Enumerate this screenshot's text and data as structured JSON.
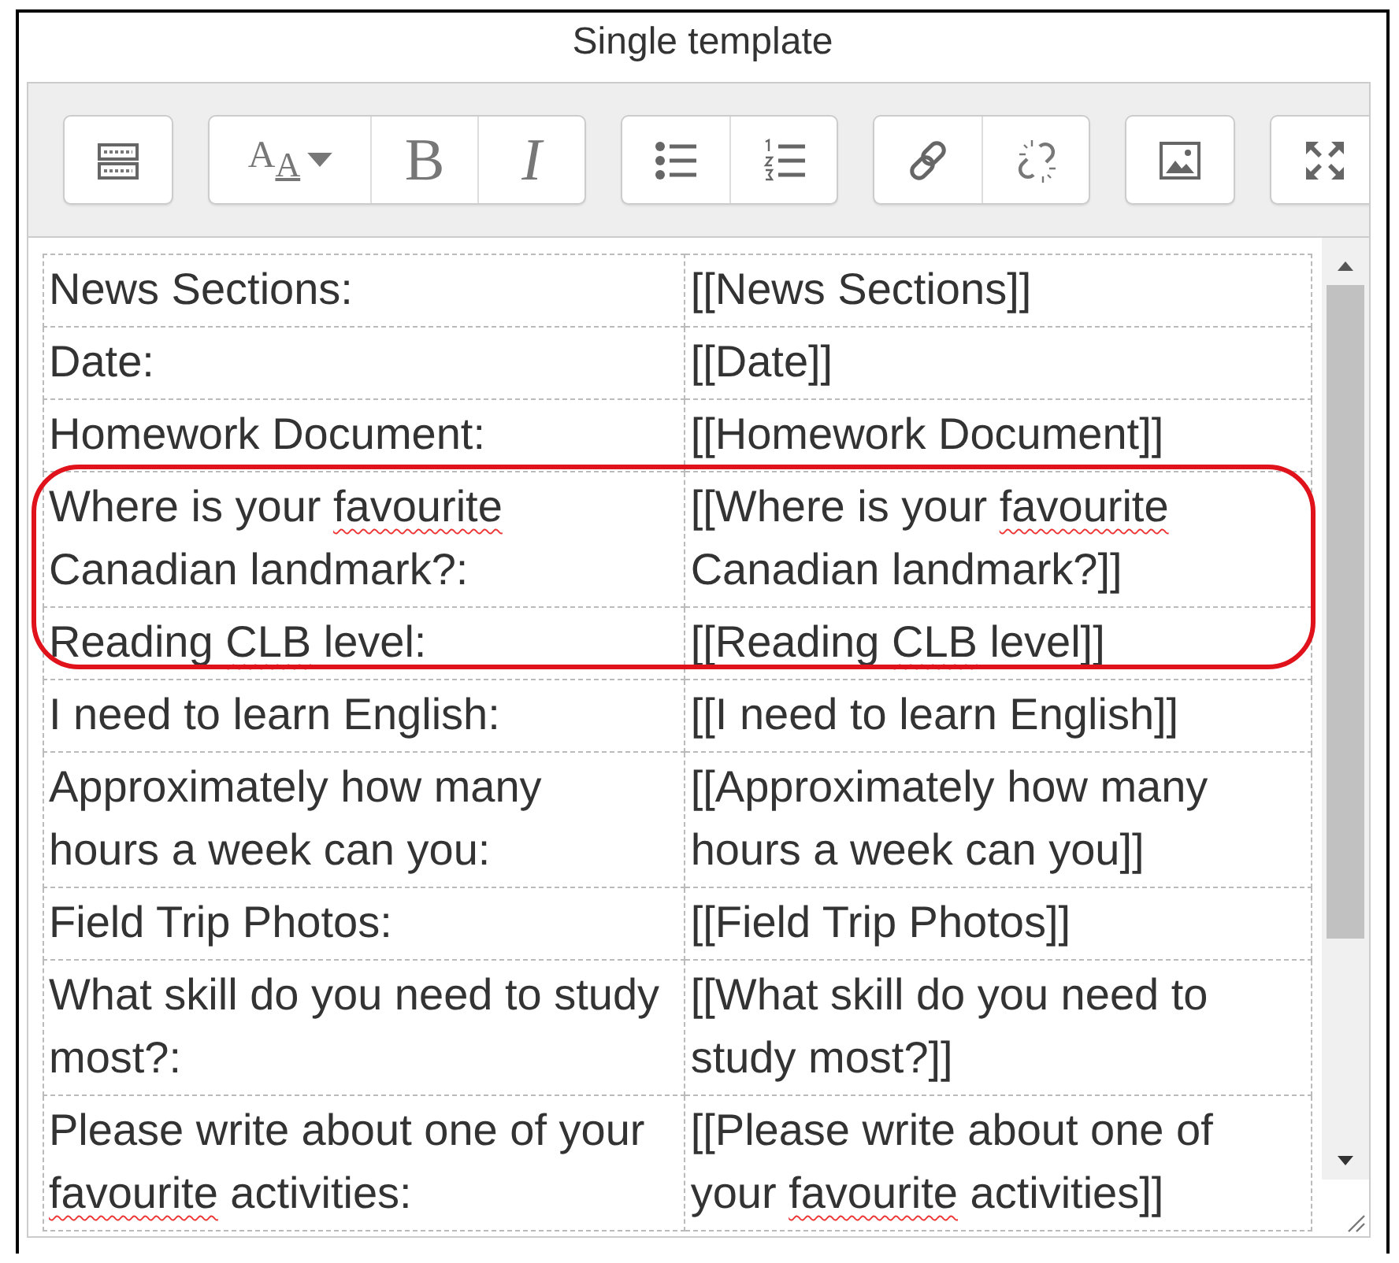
{
  "title": "Single template",
  "toolbar": [
    [
      {
        "kind": "toolbar-toggle"
      }
    ],
    [
      {
        "kind": "styles",
        "label": "A$_{A}$"
      },
      {
        "kind": "bold",
        "label": "B"
      },
      {
        "kind": "italic",
        "label": "I"
      }
    ],
    [
      {
        "kind": "bullets"
      },
      {
        "kind": "numbered"
      }
    ],
    [
      {
        "kind": "link"
      },
      {
        "kind": "unlink"
      }
    ],
    [
      {
        "kind": "image"
      }
    ],
    [
      {
        "kind": "fullscreen"
      }
    ]
  ],
  "rows": [
    {
      "highlighted": false,
      "cells": [
        [
          {
            "text": "News Sections:",
            "misspelled": false
          }
        ],
        [
          {
            "text": "[[News Sections]]",
            "misspelled": false
          }
        ]
      ]
    },
    {
      "highlighted": false,
      "cells": [
        [
          {
            "text": "Date:",
            "misspelled": false
          }
        ],
        [
          {
            "text": "[[Date]]",
            "misspelled": false
          }
        ]
      ]
    },
    {
      "highlighted": false,
      "cells": [
        [
          {
            "text": "Homework Document:",
            "misspelled": false
          }
        ],
        [
          {
            "text": "[[Homework Document]]",
            "misspelled": false
          }
        ]
      ]
    },
    {
      "highlighted": true,
      "cells": [
        [
          {
            "text": "Where is your ",
            "misspelled": false
          },
          {
            "text": "favourite",
            "misspelled": true
          },
          {
            "text": " Canadian landmark?:",
            "misspelled": false
          }
        ],
        [
          {
            "text": "[[Where is your ",
            "misspelled": false
          },
          {
            "text": "favourite",
            "misspelled": true
          },
          {
            "text": " Canadian landmark?]]",
            "misspelled": false
          }
        ]
      ]
    },
    {
      "highlighted": true,
      "cells": [
        [
          {
            "text": "Reading ",
            "misspelled": false
          },
          {
            "text": "CLB",
            "misspelled": true
          },
          {
            "text": " level:",
            "misspelled": false
          }
        ],
        [
          {
            "text": "[[Reading ",
            "misspelled": false
          },
          {
            "text": "CLB",
            "misspelled": true
          },
          {
            "text": " level]]",
            "misspelled": false
          }
        ]
      ]
    },
    {
      "highlighted": false,
      "cells": [
        [
          {
            "text": "I need to learn English:",
            "misspelled": false
          }
        ],
        [
          {
            "text": "[[I need to learn English]]",
            "misspelled": false
          }
        ]
      ]
    },
    {
      "highlighted": false,
      "cells": [
        [
          {
            "text": "Approximately how many hours a week can you:",
            "misspelled": false
          }
        ],
        [
          {
            "text": "[[Approximately how many hours a week can you]]",
            "misspelled": false
          }
        ]
      ]
    },
    {
      "highlighted": false,
      "cells": [
        [
          {
            "text": "Field Trip Photos:",
            "misspelled": false
          }
        ],
        [
          {
            "text": "[[Field Trip Photos]]",
            "misspelled": false
          }
        ]
      ]
    },
    {
      "highlighted": false,
      "cells": [
        [
          {
            "text": "What skill do you need to study most?:",
            "misspelled": false
          }
        ],
        [
          {
            "text": "[[What skill do you need to study most?]]",
            "misspelled": false
          }
        ]
      ]
    },
    {
      "highlighted": false,
      "cells": [
        [
          {
            "text": "Please write about one of your ",
            "misspelled": false
          },
          {
            "text": "favourite",
            "misspelled": true
          },
          {
            "text": " activities:",
            "misspelled": false
          }
        ],
        [
          {
            "text": "[[Please write about one of your ",
            "misspelled": false
          },
          {
            "text": "favourite",
            "misspelled": true
          },
          {
            "text": " activities]]",
            "misspelled": false
          }
        ]
      ]
    }
  ]
}
